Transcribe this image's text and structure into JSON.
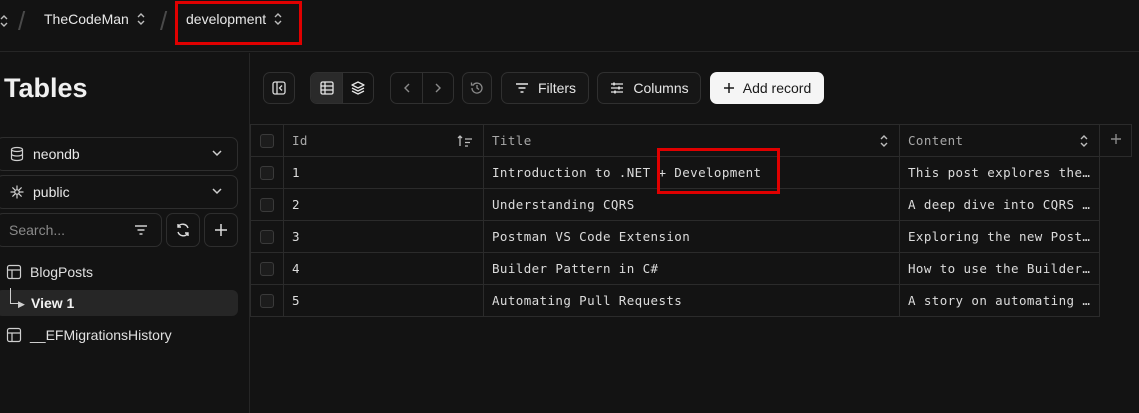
{
  "breadcrumb": {
    "project": "TheCodeMan",
    "branch": "development"
  },
  "sidebar": {
    "title": "Tables",
    "database": "neondb",
    "schema": "public",
    "search_placeholder": "Search...",
    "tables": [
      {
        "label": "BlogPosts",
        "views": [
          {
            "label": "View 1"
          }
        ]
      },
      {
        "label": "__EFMigrationsHistory"
      }
    ]
  },
  "toolbar": {
    "filters_label": "Filters",
    "columns_label": "Columns",
    "add_record_label": "Add record"
  },
  "table": {
    "columns": [
      "Id",
      "Title",
      "Content"
    ],
    "rows": [
      {
        "id": "1",
        "title": "Introduction to .NET + Development",
        "content": "This post explores the…"
      },
      {
        "id": "2",
        "title": "Understanding CQRS",
        "content": "A deep dive into CQRS …"
      },
      {
        "id": "3",
        "title": "Postman VS Code Extension",
        "content": "Exploring the new Post…"
      },
      {
        "id": "4",
        "title": "Builder Pattern in C#",
        "content": "How to use the Builder…"
      },
      {
        "id": "5",
        "title": "Automating Pull Requests",
        "content": "A story on automating …"
      }
    ]
  },
  "colors": {
    "background": "#131313",
    "border": "#2b2b2b",
    "highlight": "#e00000",
    "primary_button": "#f5f5f5"
  }
}
